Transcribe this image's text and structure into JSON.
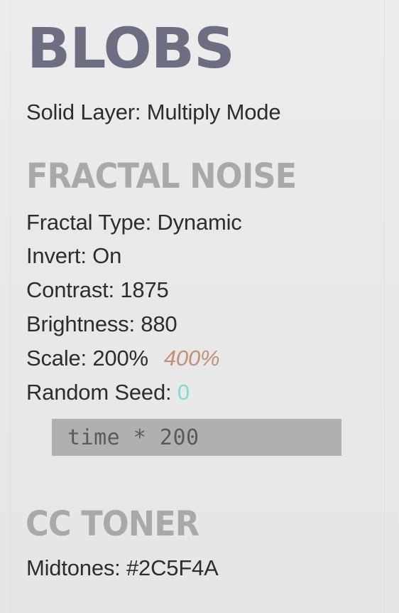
{
  "header": {
    "title": "BLOBS",
    "subtitle": "Solid Layer: Multiply Mode"
  },
  "fractal_noise": {
    "section_title": "FRACTAL NOISE",
    "fractal_type": "Fractal Type: Dynamic",
    "invert": "Invert: On",
    "contrast": "Contrast: 1875",
    "brightness": "Brightness: 880",
    "scale_label": "Scale: 200%",
    "scale_alt": "400%",
    "random_seed_label": "Random Seed: ",
    "random_seed_value": "0",
    "expression": "time * 200"
  },
  "cc_toner": {
    "section_title": "CC TONER",
    "midtones": "Midtones: #2C5F4A"
  },
  "colors": {
    "title": "#6e6e82",
    "section_title": "#a9a9a9",
    "body_text": "#2d2d2d",
    "scale_alt": "#c2907a",
    "seed_value": "#7fdccf",
    "expression_box": "#b0b0b0",
    "background": "#e9e9e9"
  }
}
